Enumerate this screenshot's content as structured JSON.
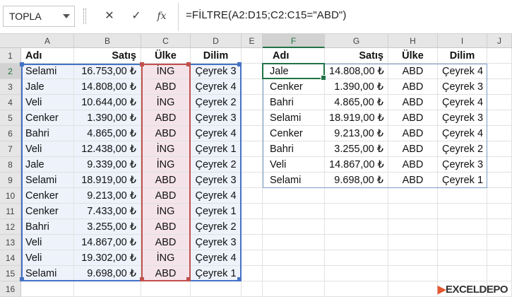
{
  "formula_bar": {
    "name_box": "TOPLA",
    "cancel_icon": "✕",
    "enter_icon": "✓",
    "function_icon": "fx",
    "formula": "=FİLTRE(A2:D15;C2:C15=\"ABD\")"
  },
  "columns": [
    "A",
    "B",
    "C",
    "D",
    "E",
    "F",
    "G",
    "H",
    "I",
    "J"
  ],
  "rows": [
    "1",
    "2",
    "3",
    "4",
    "5",
    "6",
    "7",
    "8",
    "9",
    "10",
    "11",
    "12",
    "13",
    "14",
    "15",
    "16"
  ],
  "source_table": {
    "headers": [
      "Adı",
      "Satış",
      "Ülke",
      "Dilim"
    ],
    "rows": [
      [
        "Selami",
        "16.753,00 ₺",
        "İNG",
        "Çeyrek 3"
      ],
      [
        "Jale",
        "14.808,00 ₺",
        "ABD",
        "Çeyrek 4"
      ],
      [
        "Veli",
        "10.644,00 ₺",
        "İNG",
        "Çeyrek 2"
      ],
      [
        "Cenker",
        "1.390,00 ₺",
        "ABD",
        "Çeyrek 3"
      ],
      [
        "Bahri",
        "4.865,00 ₺",
        "ABD",
        "Çeyrek 4"
      ],
      [
        "Veli",
        "12.438,00 ₺",
        "İNG",
        "Çeyrek 1"
      ],
      [
        "Jale",
        "9.339,00 ₺",
        "İNG",
        "Çeyrek 2"
      ],
      [
        "Selami",
        "18.919,00 ₺",
        "ABD",
        "Çeyrek 3"
      ],
      [
        "Cenker",
        "9.213,00 ₺",
        "ABD",
        "Çeyrek 4"
      ],
      [
        "Cenker",
        "7.433,00 ₺",
        "İNG",
        "Çeyrek 1"
      ],
      [
        "Bahri",
        "3.255,00 ₺",
        "ABD",
        "Çeyrek 2"
      ],
      [
        "Veli",
        "14.867,00 ₺",
        "ABD",
        "Çeyrek 3"
      ],
      [
        "Veli",
        "19.302,00 ₺",
        "İNG",
        "Çeyrek 4"
      ],
      [
        "Selami",
        "9.698,00 ₺",
        "ABD",
        "Çeyrek 1"
      ]
    ]
  },
  "result_table": {
    "headers": [
      "Adı",
      "Satış",
      "Ülke",
      "Dilim"
    ],
    "rows": [
      [
        "Jale",
        "14.808,00 ₺",
        "ABD",
        "Çeyrek 4"
      ],
      [
        "Cenker",
        "1.390,00 ₺",
        "ABD",
        "Çeyrek 3"
      ],
      [
        "Bahri",
        "4.865,00 ₺",
        "ABD",
        "Çeyrek 4"
      ],
      [
        "Selami",
        "18.919,00 ₺",
        "ABD",
        "Çeyrek 3"
      ],
      [
        "Cenker",
        "9.213,00 ₺",
        "ABD",
        "Çeyrek 4"
      ],
      [
        "Bahri",
        "3.255,00 ₺",
        "ABD",
        "Çeyrek 2"
      ],
      [
        "Veli",
        "14.867,00 ₺",
        "ABD",
        "Çeyrek 3"
      ],
      [
        "Selami",
        "9.698,00 ₺",
        "ABD",
        "Çeyrek 1"
      ]
    ]
  },
  "watermark": {
    "prefix": "EXCEL",
    "suffix": "DEPO"
  },
  "colors": {
    "selection_green": "#217346",
    "range_blue": "#4472c4",
    "range_red": "#c0504d"
  }
}
